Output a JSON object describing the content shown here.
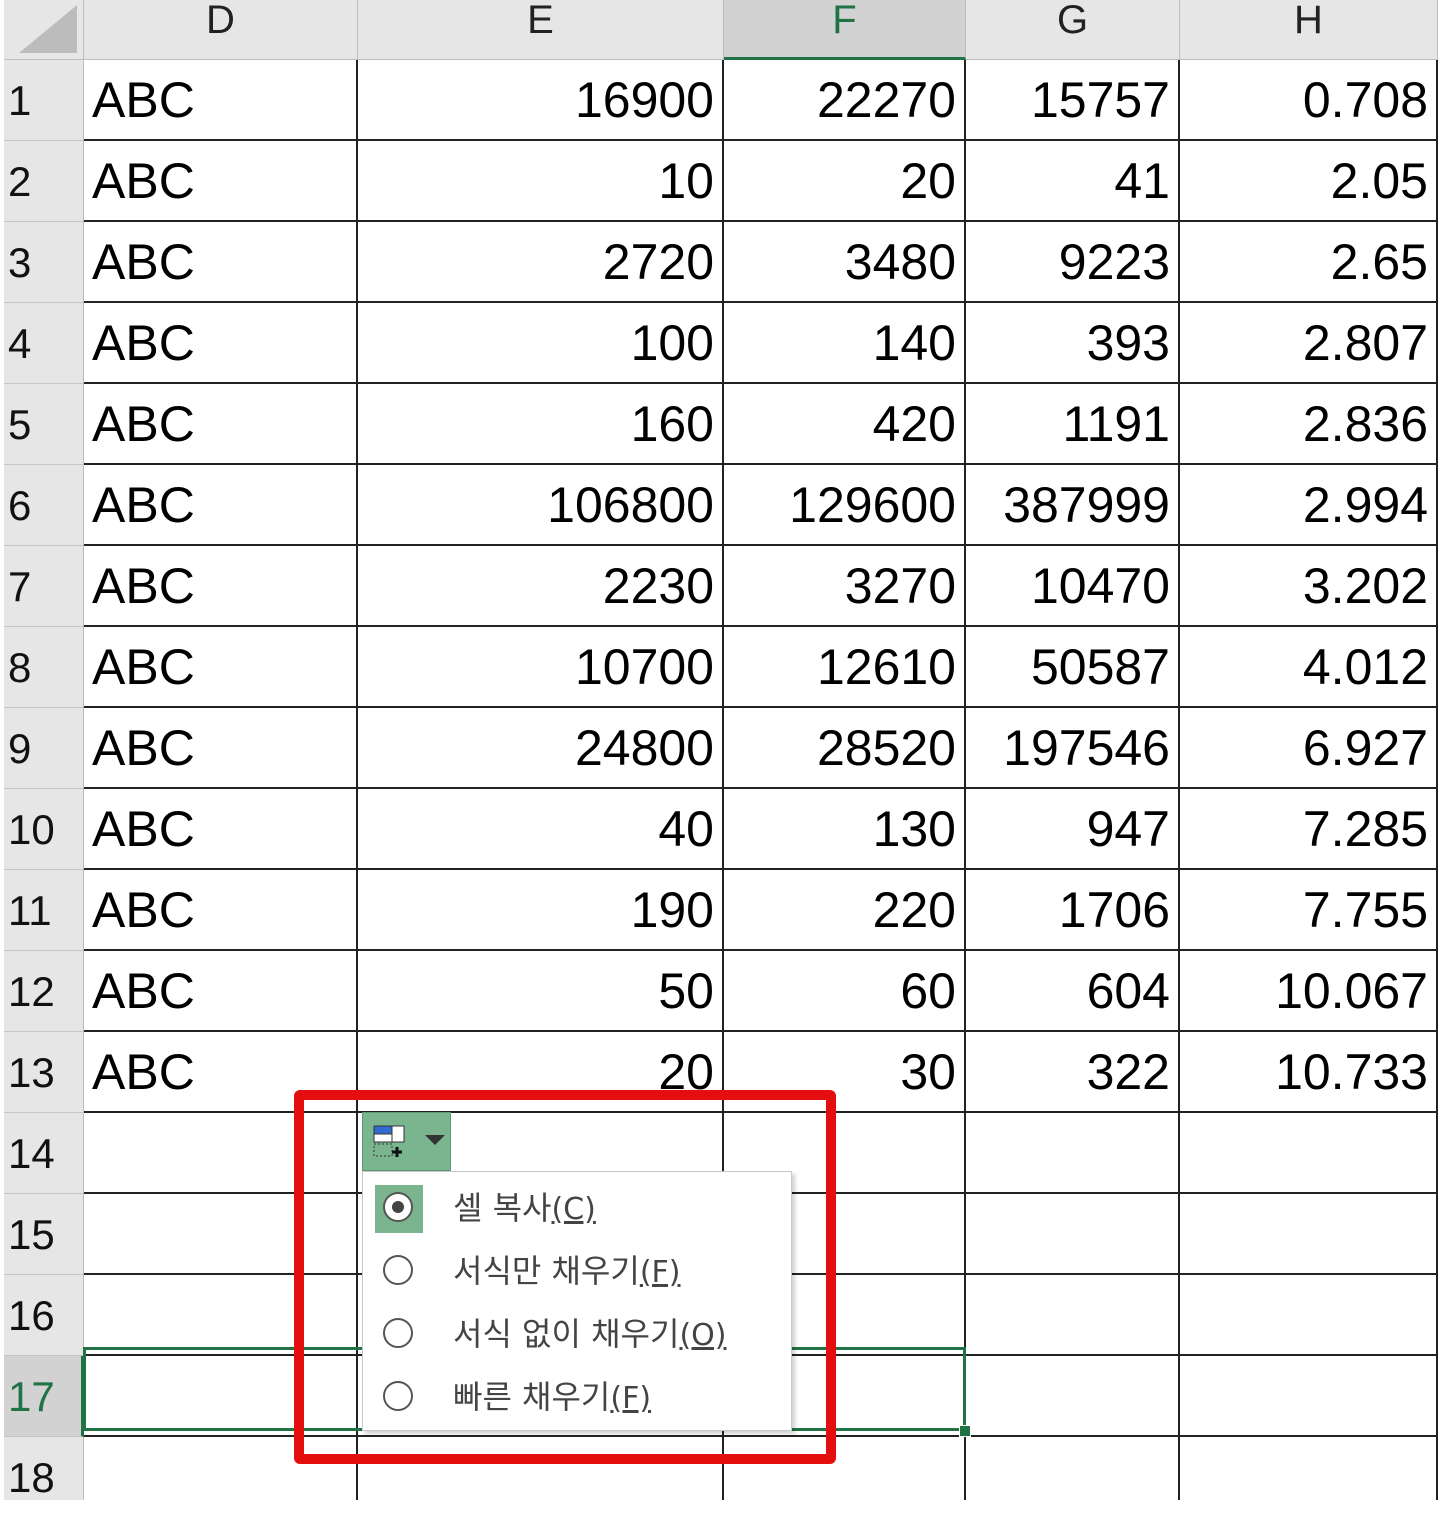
{
  "columns": [
    "D",
    "E",
    "F",
    "G",
    "H"
  ],
  "active_column": "F",
  "rows": [
    {
      "n": "1",
      "d": "ABC",
      "e": "16900",
      "f": "22270",
      "g": "15757",
      "h": "0.708"
    },
    {
      "n": "2",
      "d": "ABC",
      "e": "10",
      "f": "20",
      "g": "41",
      "h": "2.05"
    },
    {
      "n": "3",
      "d": "ABC",
      "e": "2720",
      "f": "3480",
      "g": "9223",
      "h": "2.65"
    },
    {
      "n": "4",
      "d": "ABC",
      "e": "100",
      "f": "140",
      "g": "393",
      "h": "2.807"
    },
    {
      "n": "5",
      "d": "ABC",
      "e": "160",
      "f": "420",
      "g": "1191",
      "h": "2.836"
    },
    {
      "n": "6",
      "d": "ABC",
      "e": "106800",
      "f": "129600",
      "g": "387999",
      "h": "2.994"
    },
    {
      "n": "7",
      "d": "ABC",
      "e": "2230",
      "f": "3270",
      "g": "10470",
      "h": "3.202"
    },
    {
      "n": "8",
      "d": "ABC",
      "e": "10700",
      "f": "12610",
      "g": "50587",
      "h": "4.012"
    },
    {
      "n": "9",
      "d": "ABC",
      "e": "24800",
      "f": "28520",
      "g": "197546",
      "h": "6.927"
    },
    {
      "n": "10",
      "d": "ABC",
      "e": "40",
      "f": "130",
      "g": "947",
      "h": "7.285"
    },
    {
      "n": "11",
      "d": "ABC",
      "e": "190",
      "f": "220",
      "g": "1706",
      "h": "7.755"
    },
    {
      "n": "12",
      "d": "ABC",
      "e": "50",
      "f": "60",
      "g": "604",
      "h": "10.067"
    },
    {
      "n": "13",
      "d": "ABC",
      "e": "20",
      "f": "30",
      "g": "322",
      "h": "10.733"
    },
    {
      "n": "14",
      "d": "",
      "e": "",
      "f": "",
      "g": "",
      "h": ""
    },
    {
      "n": "15",
      "d": "",
      "e": "",
      "f": "",
      "g": "",
      "h": ""
    },
    {
      "n": "16",
      "d": "",
      "e": "",
      "f": "",
      "g": "",
      "h": ""
    },
    {
      "n": "17",
      "d": "",
      "e": "",
      "f": "",
      "g": "",
      "h": ""
    },
    {
      "n": "18",
      "d": "",
      "e": "",
      "f": "",
      "g": "",
      "h": ""
    }
  ],
  "active_row": "17",
  "autofill_menu": {
    "button_icon": "autofill-options-icon",
    "options": [
      {
        "label": "셀 복사",
        "key": "(C)",
        "checked": true
      },
      {
        "label": "서식만 채우기",
        "key": "(F)",
        "checked": false
      },
      {
        "label": "서식 없이 채우기",
        "key": "(O)",
        "checked": false
      },
      {
        "label": "빠른 채우기",
        "key": "(F)",
        "checked": false
      }
    ]
  },
  "colors": {
    "accent_green": "#217346",
    "highlight_green": "#7ab58f",
    "annotation_red": "#e50e0e"
  }
}
